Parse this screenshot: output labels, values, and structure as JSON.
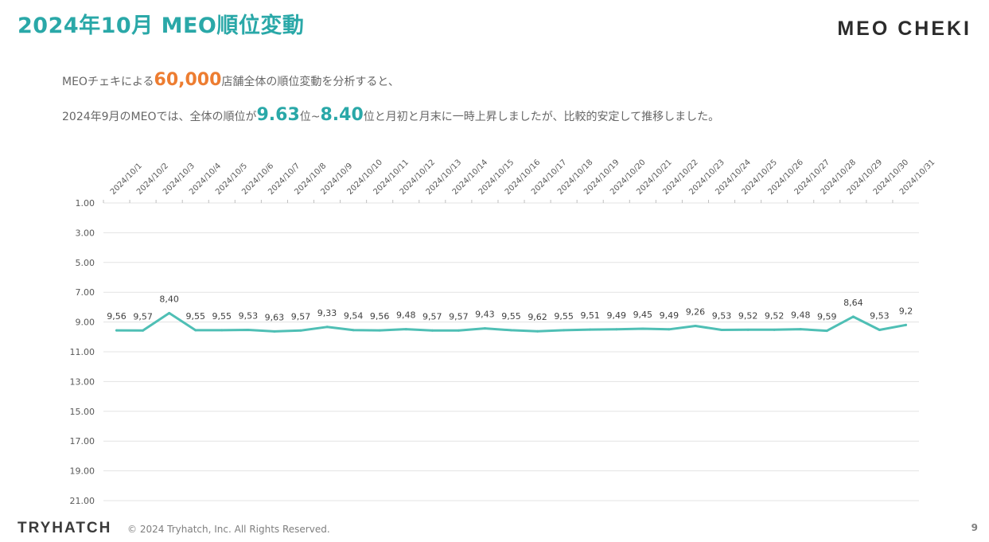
{
  "header": {
    "title": "2024年10月 MEO順位変動",
    "logo": "MEO CHEKI"
  },
  "summary": {
    "line1_pre": "MEOチェキによる",
    "line1_num": "60,000",
    "line1_post": "店舗全体の順位変動を分析すると、",
    "line2_pre": "2024年9月のMEOでは、全体の順位が",
    "line2_num1": "9.63",
    "line2_mid1": "位~",
    "line2_num2": "8.40",
    "line2_post": "位と月初と月末に一時上昇しましたが、比較的安定して推移しました。",
    "accent_orange": "#ed7d31",
    "accent_teal": "#2aa8a8"
  },
  "chart_data": {
    "type": "line",
    "categories": [
      "2024/10/1",
      "2024/10/2",
      "2024/10/3",
      "2024/10/4",
      "2024/10/5",
      "2024/10/6",
      "2024/10/7",
      "2024/10/8",
      "2024/10/9",
      "2024/10/10",
      "2024/10/11",
      "2024/10/12",
      "2024/10/13",
      "2024/10/14",
      "2024/10/15",
      "2024/10/16",
      "2024/10/17",
      "2024/10/18",
      "2024/10/19",
      "2024/10/20",
      "2024/10/21",
      "2024/10/22",
      "2024/10/23",
      "2024/10/24",
      "2024/10/25",
      "2024/10/26",
      "2024/10/27",
      "2024/10/28",
      "2024/10/29",
      "2024/10/30",
      "2024/10/31"
    ],
    "values": [
      9.56,
      9.57,
      8.4,
      9.55,
      9.55,
      9.53,
      9.63,
      9.57,
      9.33,
      9.54,
      9.56,
      9.48,
      9.57,
      9.57,
      9.43,
      9.55,
      9.62,
      9.55,
      9.51,
      9.49,
      9.45,
      9.49,
      9.26,
      9.53,
      9.52,
      9.52,
      9.48,
      9.59,
      8.64,
      9.53,
      9.2
    ],
    "data_labels": [
      "9,56",
      "9,57",
      "8,40",
      "9,55",
      "9,55",
      "9,53",
      "9,63",
      "9,57",
      "9,33",
      "9,54",
      "9,56",
      "9,48",
      "9,57",
      "9,57",
      "9,43",
      "9,55",
      "9,62",
      "9,55",
      "9,51",
      "9,49",
      "9,45",
      "9,49",
      "9,26",
      "9,53",
      "9,52",
      "9,52",
      "9,48",
      "9,59",
      "8,64",
      "9,53",
      "9,2"
    ],
    "y_ticks": [
      "1.00",
      "3.00",
      "5.00",
      "7.00",
      "9.00",
      "11.00",
      "13.00",
      "15.00",
      "17.00",
      "19.00",
      "21.00"
    ],
    "ylim": [
      1,
      21
    ],
    "y_reversed": true,
    "grid": true,
    "line_color": "#4fbfb5",
    "grid_color": "#e3e3e3"
  },
  "footer": {
    "company": "TRYHATCH",
    "copyright": "© 2024 Tryhatch, Inc. All Rights Reserved.",
    "page": "9"
  }
}
